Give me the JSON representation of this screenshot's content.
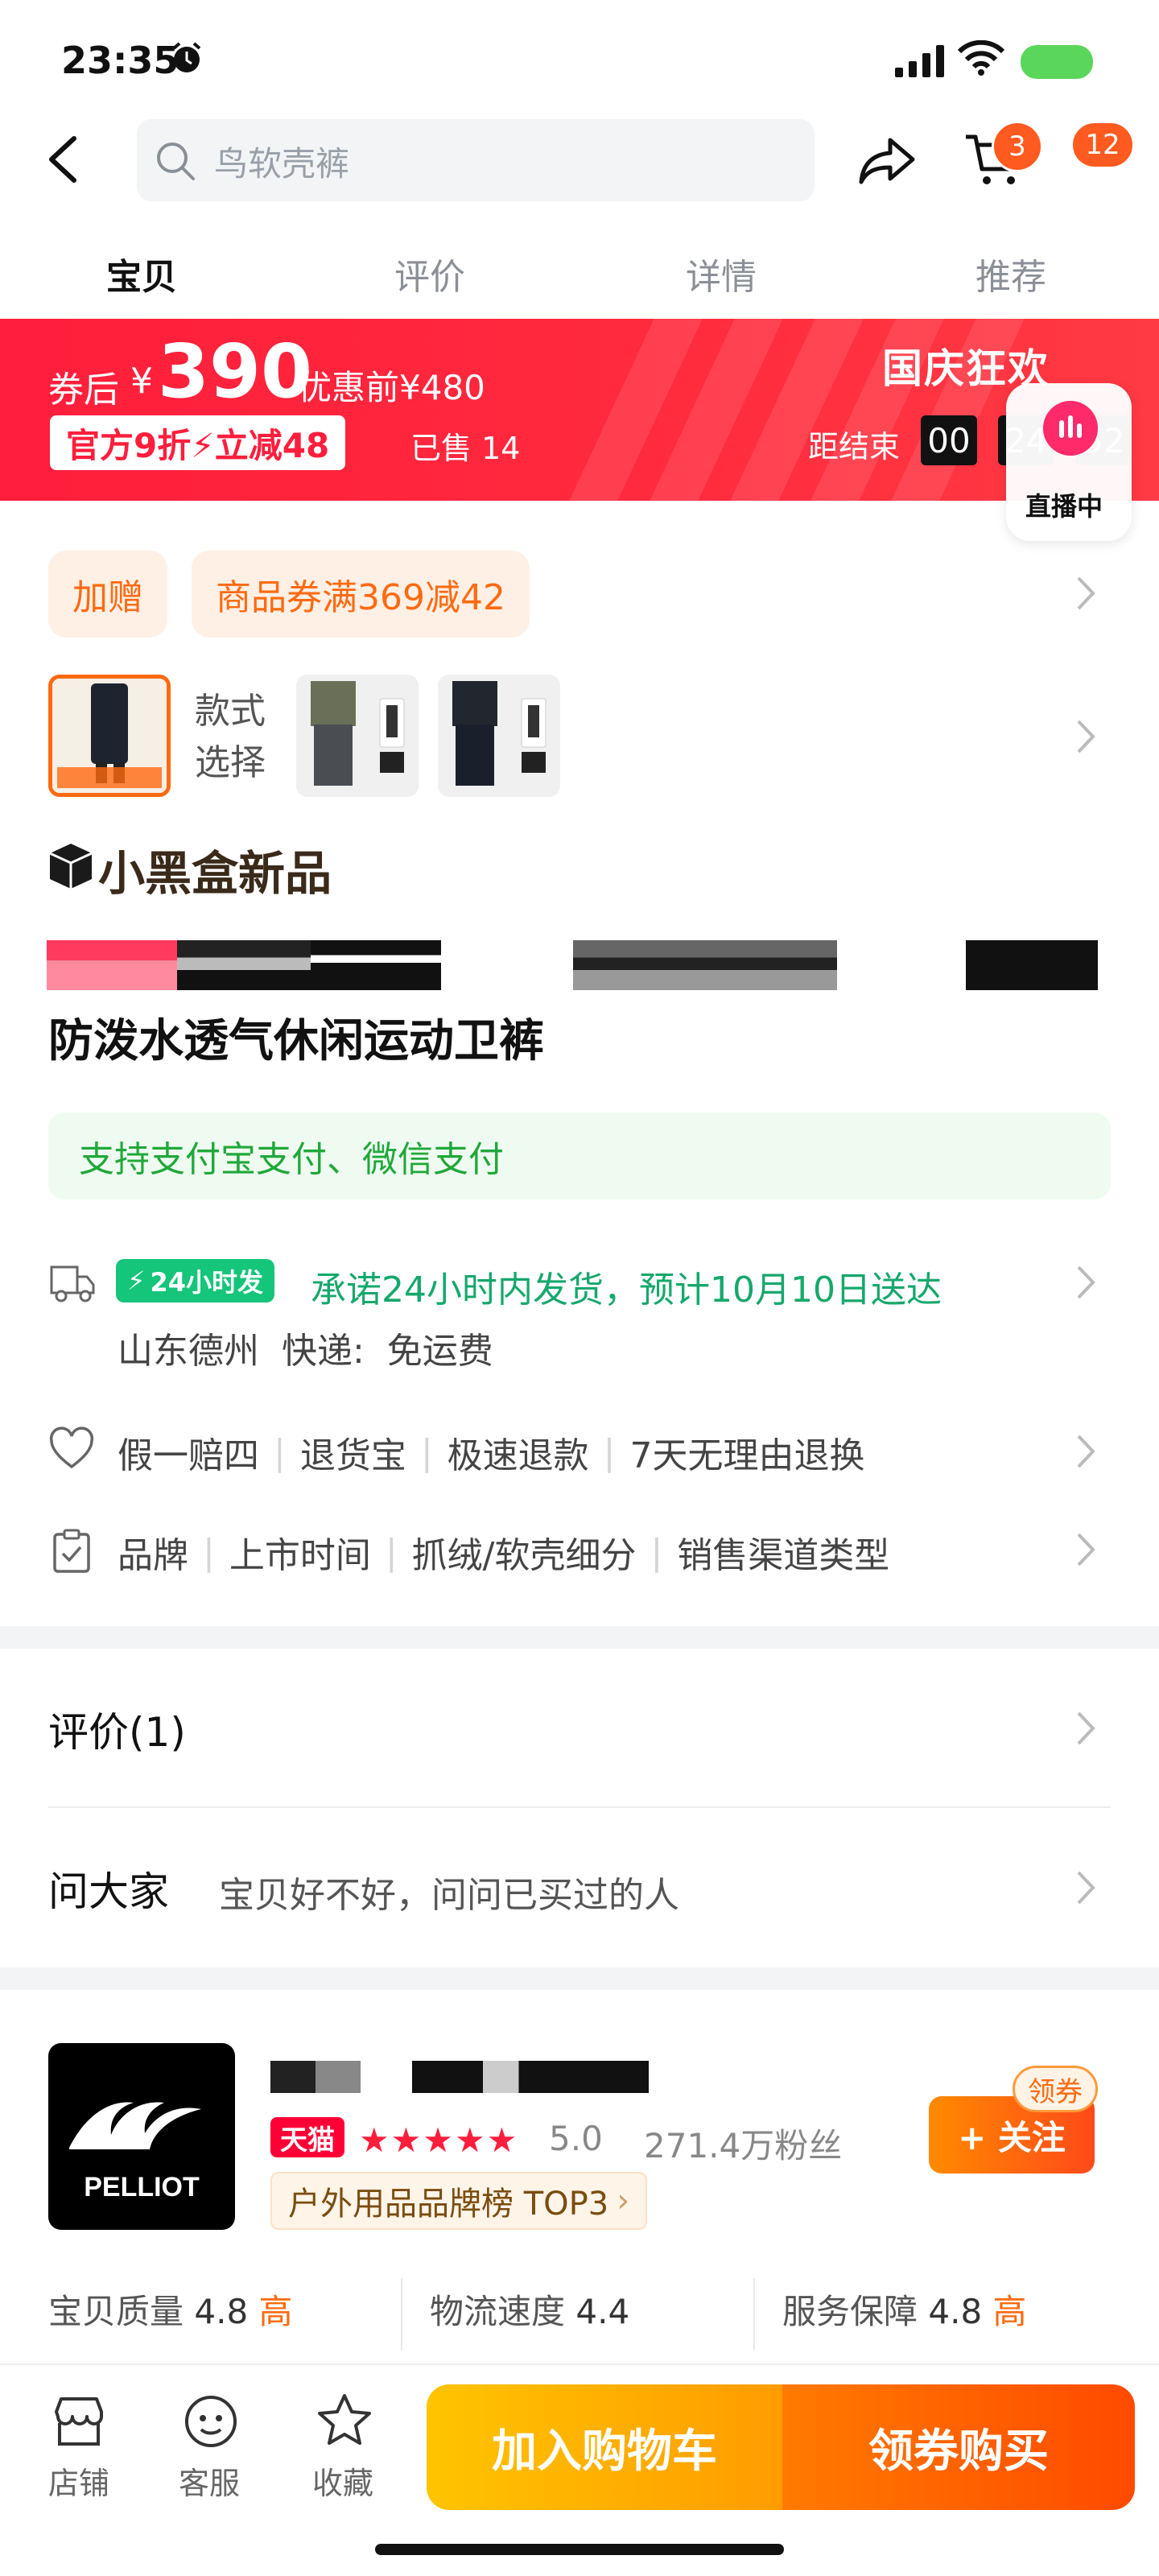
{
  "status_bar": {
    "time": "23:35"
  },
  "header": {
    "search_placeholder": "鸟软壳裤",
    "cart_badge": "3",
    "more_badge": "12"
  },
  "tabs": [
    "宝贝",
    "评价",
    "详情",
    "推荐"
  ],
  "promo": {
    "after_label": "券后",
    "currency": "¥",
    "price": "390",
    "before_price": "优惠前¥480",
    "tag": "官方9折⚡立减48",
    "sold": "已售 14",
    "festival": "国庆狂欢",
    "ends_label": "距结束",
    "timer": [
      "00",
      "24",
      "52"
    ],
    "live_label": "直播中"
  },
  "coupons": {
    "gift": "加赠",
    "coupon": "商品券满369减42"
  },
  "style_select": {
    "label": "款式\n选择"
  },
  "new_product": {
    "title": "小黑盒新品"
  },
  "product": {
    "title": "防泼水透气休闲运动卫裤"
  },
  "payment": "支持支付宝支付、微信支付",
  "delivery": {
    "badge": "24小时发",
    "promise": "承诺24小时内发货，预计10月10日送达",
    "origin": "山东德州  快递:  免运费"
  },
  "services": [
    "假一赔四",
    "退货宝",
    "极速退款",
    "7天无理由退换"
  ],
  "params": [
    "品牌",
    "上市时间",
    "抓绒/软壳细分",
    "销售渠道类型"
  ],
  "reviews": {
    "title": "评价(1)"
  },
  "qa": {
    "title": "问大家",
    "subtitle": "宝贝好不好，问问已买过的人"
  },
  "store": {
    "logo_text": "PELLIOT",
    "tmall": "天猫",
    "stars": "★★★★★",
    "score": "5.0",
    "fans": "271.4万粉丝",
    "rank": "户外用品品牌榜 TOP3",
    "follow": "+ 关注",
    "coupon_tag": "领券",
    "metrics": [
      {
        "label": "宝贝质量",
        "value": "4.8",
        "level": "高"
      },
      {
        "label": "物流速度",
        "value": "4.4",
        "level": ""
      },
      {
        "label": "服务保障",
        "value": "4.8",
        "level": "高"
      }
    ]
  },
  "bottom_bar": {
    "shop": "店铺",
    "service": "客服",
    "favorite": "收藏",
    "add_to_cart": "加入购物车",
    "buy": "领券购买"
  },
  "colors": {
    "accent": "#ff6a10",
    "promo_red": "#ff1e3c",
    "green": "#16a86c"
  }
}
